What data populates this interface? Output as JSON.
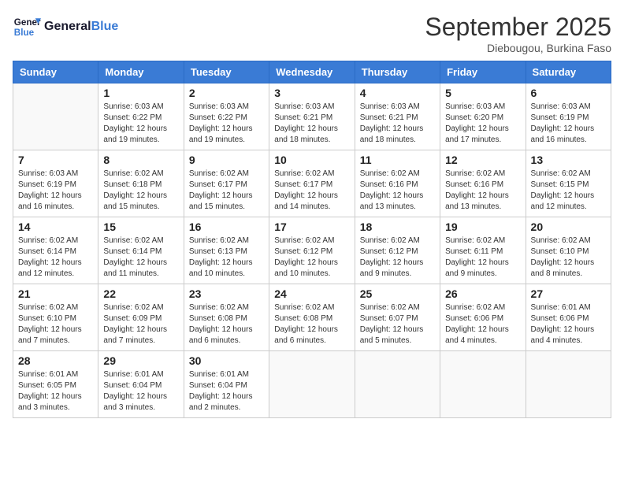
{
  "logo": {
    "line1": "General",
    "line2": "Blue"
  },
  "title": "September 2025",
  "location": "Diebougou, Burkina Faso",
  "weekdays": [
    "Sunday",
    "Monday",
    "Tuesday",
    "Wednesday",
    "Thursday",
    "Friday",
    "Saturday"
  ],
  "weeks": [
    [
      {
        "day": null,
        "info": null
      },
      {
        "day": "1",
        "info": "Sunrise: 6:03 AM\nSunset: 6:22 PM\nDaylight: 12 hours\nand 19 minutes."
      },
      {
        "day": "2",
        "info": "Sunrise: 6:03 AM\nSunset: 6:22 PM\nDaylight: 12 hours\nand 19 minutes."
      },
      {
        "day": "3",
        "info": "Sunrise: 6:03 AM\nSunset: 6:21 PM\nDaylight: 12 hours\nand 18 minutes."
      },
      {
        "day": "4",
        "info": "Sunrise: 6:03 AM\nSunset: 6:21 PM\nDaylight: 12 hours\nand 18 minutes."
      },
      {
        "day": "5",
        "info": "Sunrise: 6:03 AM\nSunset: 6:20 PM\nDaylight: 12 hours\nand 17 minutes."
      },
      {
        "day": "6",
        "info": "Sunrise: 6:03 AM\nSunset: 6:19 PM\nDaylight: 12 hours\nand 16 minutes."
      }
    ],
    [
      {
        "day": "7",
        "info": "Sunrise: 6:03 AM\nSunset: 6:19 PM\nDaylight: 12 hours\nand 16 minutes."
      },
      {
        "day": "8",
        "info": "Sunrise: 6:02 AM\nSunset: 6:18 PM\nDaylight: 12 hours\nand 15 minutes."
      },
      {
        "day": "9",
        "info": "Sunrise: 6:02 AM\nSunset: 6:17 PM\nDaylight: 12 hours\nand 15 minutes."
      },
      {
        "day": "10",
        "info": "Sunrise: 6:02 AM\nSunset: 6:17 PM\nDaylight: 12 hours\nand 14 minutes."
      },
      {
        "day": "11",
        "info": "Sunrise: 6:02 AM\nSunset: 6:16 PM\nDaylight: 12 hours\nand 13 minutes."
      },
      {
        "day": "12",
        "info": "Sunrise: 6:02 AM\nSunset: 6:16 PM\nDaylight: 12 hours\nand 13 minutes."
      },
      {
        "day": "13",
        "info": "Sunrise: 6:02 AM\nSunset: 6:15 PM\nDaylight: 12 hours\nand 12 minutes."
      }
    ],
    [
      {
        "day": "14",
        "info": "Sunrise: 6:02 AM\nSunset: 6:14 PM\nDaylight: 12 hours\nand 12 minutes."
      },
      {
        "day": "15",
        "info": "Sunrise: 6:02 AM\nSunset: 6:14 PM\nDaylight: 12 hours\nand 11 minutes."
      },
      {
        "day": "16",
        "info": "Sunrise: 6:02 AM\nSunset: 6:13 PM\nDaylight: 12 hours\nand 10 minutes."
      },
      {
        "day": "17",
        "info": "Sunrise: 6:02 AM\nSunset: 6:12 PM\nDaylight: 12 hours\nand 10 minutes."
      },
      {
        "day": "18",
        "info": "Sunrise: 6:02 AM\nSunset: 6:12 PM\nDaylight: 12 hours\nand 9 minutes."
      },
      {
        "day": "19",
        "info": "Sunrise: 6:02 AM\nSunset: 6:11 PM\nDaylight: 12 hours\nand 9 minutes."
      },
      {
        "day": "20",
        "info": "Sunrise: 6:02 AM\nSunset: 6:10 PM\nDaylight: 12 hours\nand 8 minutes."
      }
    ],
    [
      {
        "day": "21",
        "info": "Sunrise: 6:02 AM\nSunset: 6:10 PM\nDaylight: 12 hours\nand 7 minutes."
      },
      {
        "day": "22",
        "info": "Sunrise: 6:02 AM\nSunset: 6:09 PM\nDaylight: 12 hours\nand 7 minutes."
      },
      {
        "day": "23",
        "info": "Sunrise: 6:02 AM\nSunset: 6:08 PM\nDaylight: 12 hours\nand 6 minutes."
      },
      {
        "day": "24",
        "info": "Sunrise: 6:02 AM\nSunset: 6:08 PM\nDaylight: 12 hours\nand 6 minutes."
      },
      {
        "day": "25",
        "info": "Sunrise: 6:02 AM\nSunset: 6:07 PM\nDaylight: 12 hours\nand 5 minutes."
      },
      {
        "day": "26",
        "info": "Sunrise: 6:02 AM\nSunset: 6:06 PM\nDaylight: 12 hours\nand 4 minutes."
      },
      {
        "day": "27",
        "info": "Sunrise: 6:01 AM\nSunset: 6:06 PM\nDaylight: 12 hours\nand 4 minutes."
      }
    ],
    [
      {
        "day": "28",
        "info": "Sunrise: 6:01 AM\nSunset: 6:05 PM\nDaylight: 12 hours\nand 3 minutes."
      },
      {
        "day": "29",
        "info": "Sunrise: 6:01 AM\nSunset: 6:04 PM\nDaylight: 12 hours\nand 3 minutes."
      },
      {
        "day": "30",
        "info": "Sunrise: 6:01 AM\nSunset: 6:04 PM\nDaylight: 12 hours\nand 2 minutes."
      },
      {
        "day": null,
        "info": null
      },
      {
        "day": null,
        "info": null
      },
      {
        "day": null,
        "info": null
      },
      {
        "day": null,
        "info": null
      }
    ]
  ]
}
